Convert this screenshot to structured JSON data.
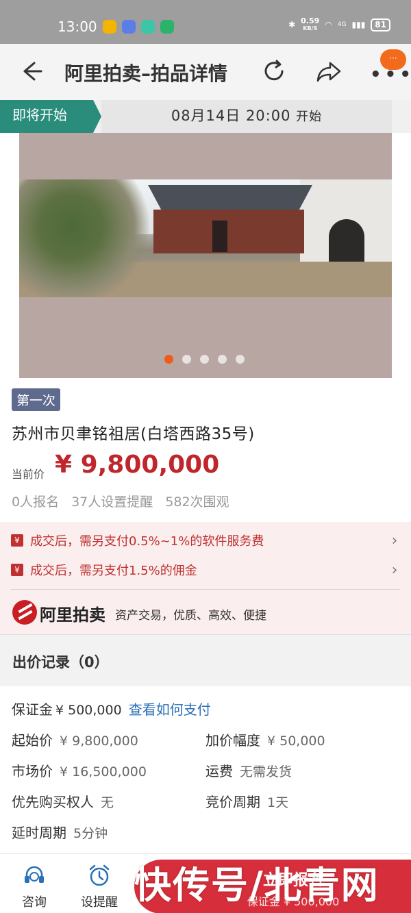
{
  "status_bar": {
    "time": "13:00",
    "net_speed_value": "0.59",
    "net_speed_unit": "KB/S",
    "signal": "4G",
    "battery": "81"
  },
  "header": {
    "title": "阿里拍卖–拍品详情",
    "notify_badge": "···"
  },
  "auction_status": {
    "tag": "即将开始",
    "start_time": "08月14日 20:00",
    "start_suffix": "开始"
  },
  "gallery": {
    "total_images": 5,
    "active_index": 0
  },
  "item": {
    "round": "第一次",
    "title": "苏州市贝聿铭祖居(白塔西路35号)",
    "price_label": "当前价",
    "price": "¥ 9,800,000",
    "signups": "0人报名",
    "reminders": "37人设置提醒",
    "views": "582次围观"
  },
  "fees": {
    "icon_char": "¥",
    "service_fee": "成交后，需另支付0.5%~1%的软件服务费",
    "commission": "成交后，需另支付1.5%的佣金",
    "brand": "阿里拍卖",
    "slogan": "资产交易，优质、高效、便捷"
  },
  "bid_record": {
    "label": "出价记录（0）"
  },
  "details": {
    "deposit_label": "保证金",
    "deposit_value": "¥ 500,000",
    "deposit_link": "查看如何支付",
    "start_price_label": "起始价",
    "start_price_value": "¥ 9,800,000",
    "increment_label": "加价幅度",
    "increment_value": "¥ 50,000",
    "market_price_label": "市场价",
    "market_price_value": "¥ 16,500,000",
    "shipping_label": "运费",
    "shipping_value": "无需发货",
    "priority_label": "优先购买权人",
    "priority_value": "无",
    "cycle_label": "竞价周期",
    "cycle_value": "1天",
    "delay_label": "延时周期",
    "delay_value": "5分钟"
  },
  "bottom_bar": {
    "consult": "咨询",
    "reminder": "设提醒",
    "signup": "立即报名",
    "signup_deposit": "保证金 ¥ 500,000"
  },
  "watermark": "快传号/北青网",
  "colors": {
    "accent_red": "#c0272d",
    "teal_tag": "#2a8c7a",
    "link_blue": "#2a6fb8",
    "orange_dot": "#f05a1a"
  }
}
